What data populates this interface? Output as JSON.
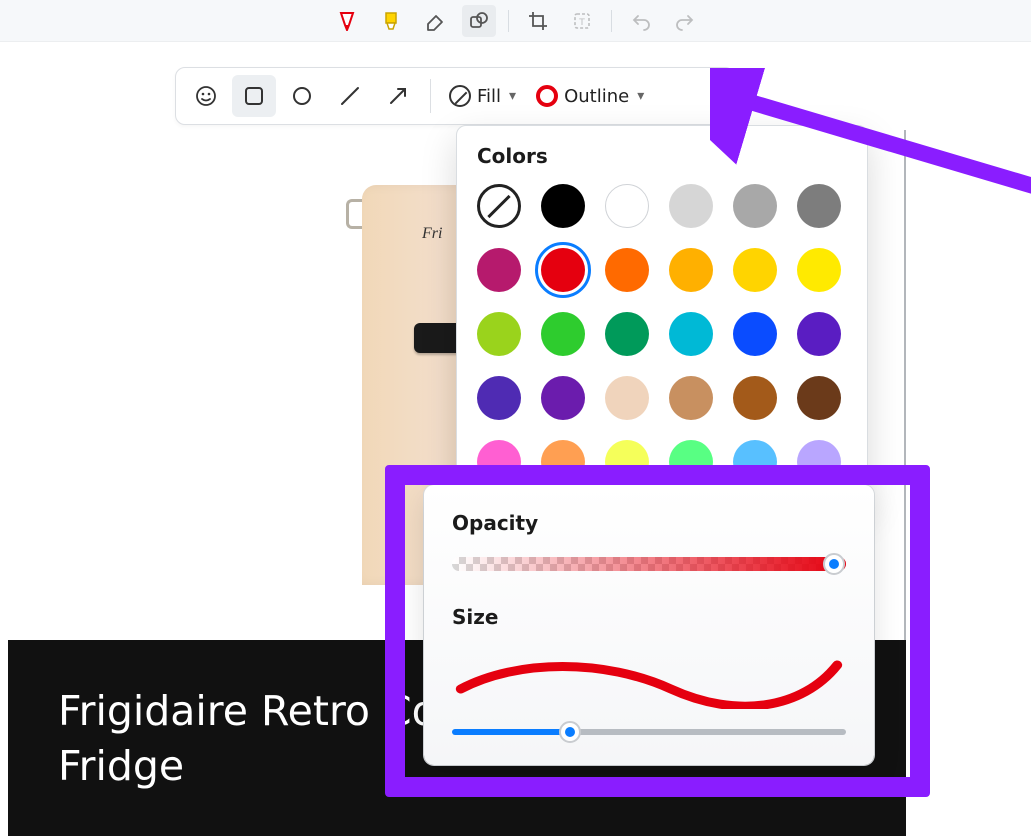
{
  "topToolbar": {
    "items": [
      {
        "name": "pen-red-icon"
      },
      {
        "name": "highlighter-yellow-icon"
      },
      {
        "name": "eraser-icon"
      },
      {
        "name": "shapes-icon",
        "active": true
      },
      {
        "sep": true
      },
      {
        "name": "crop-icon"
      },
      {
        "name": "ocr-icon",
        "disabled": true
      },
      {
        "sep": true
      },
      {
        "name": "undo-icon",
        "disabled": true
      },
      {
        "name": "redo-icon",
        "disabled": true
      }
    ]
  },
  "shapesBar": {
    "emoji": "emoji-icon",
    "rect": "rectangle-shape",
    "rectSelected": true,
    "circle": "circle-shape",
    "line": "line-shape",
    "arrow": "arrow-shape",
    "fillLabel": "Fill",
    "outlineLabel": "Outline"
  },
  "popover": {
    "colorsHeading": "Colors",
    "opacityHeading": "Opacity",
    "sizeHeading": "Size",
    "opacityValuePct": 100,
    "sizeValuePct": 30,
    "selectedColor": "#e5000f",
    "colors": [
      "none",
      "#000000",
      "#ffffff",
      "#d6d6d6",
      "#a8a8a8",
      "#7d7d7d",
      "#b61a6d",
      "#e5000f",
      "#ff6a00",
      "#ffb000",
      "#ffd400",
      "#ffea00",
      "#9ad31c",
      "#2ecc2e",
      "#009a5a",
      "#00b9d6",
      "#0a4cff",
      "#5a1dc2",
      "#4f2bb3",
      "#6b1cad",
      "#f0d4bc",
      "#c89060",
      "#a35a1a",
      "#6b3a1a",
      "#ff5fd2",
      "#ff9f52",
      "#f5ff5a",
      "#58ff83",
      "#58c0ff",
      "#b9a6ff"
    ]
  },
  "page": {
    "title": "Frigidaire Retro Compact Fridge",
    "titleVisible": "Frigidaire Retro Compa\nFridge",
    "fridgeLogo": "Fri"
  },
  "annotation": {
    "highlightColor": "#8a1dff",
    "arrowColor": "#8a1dff"
  }
}
